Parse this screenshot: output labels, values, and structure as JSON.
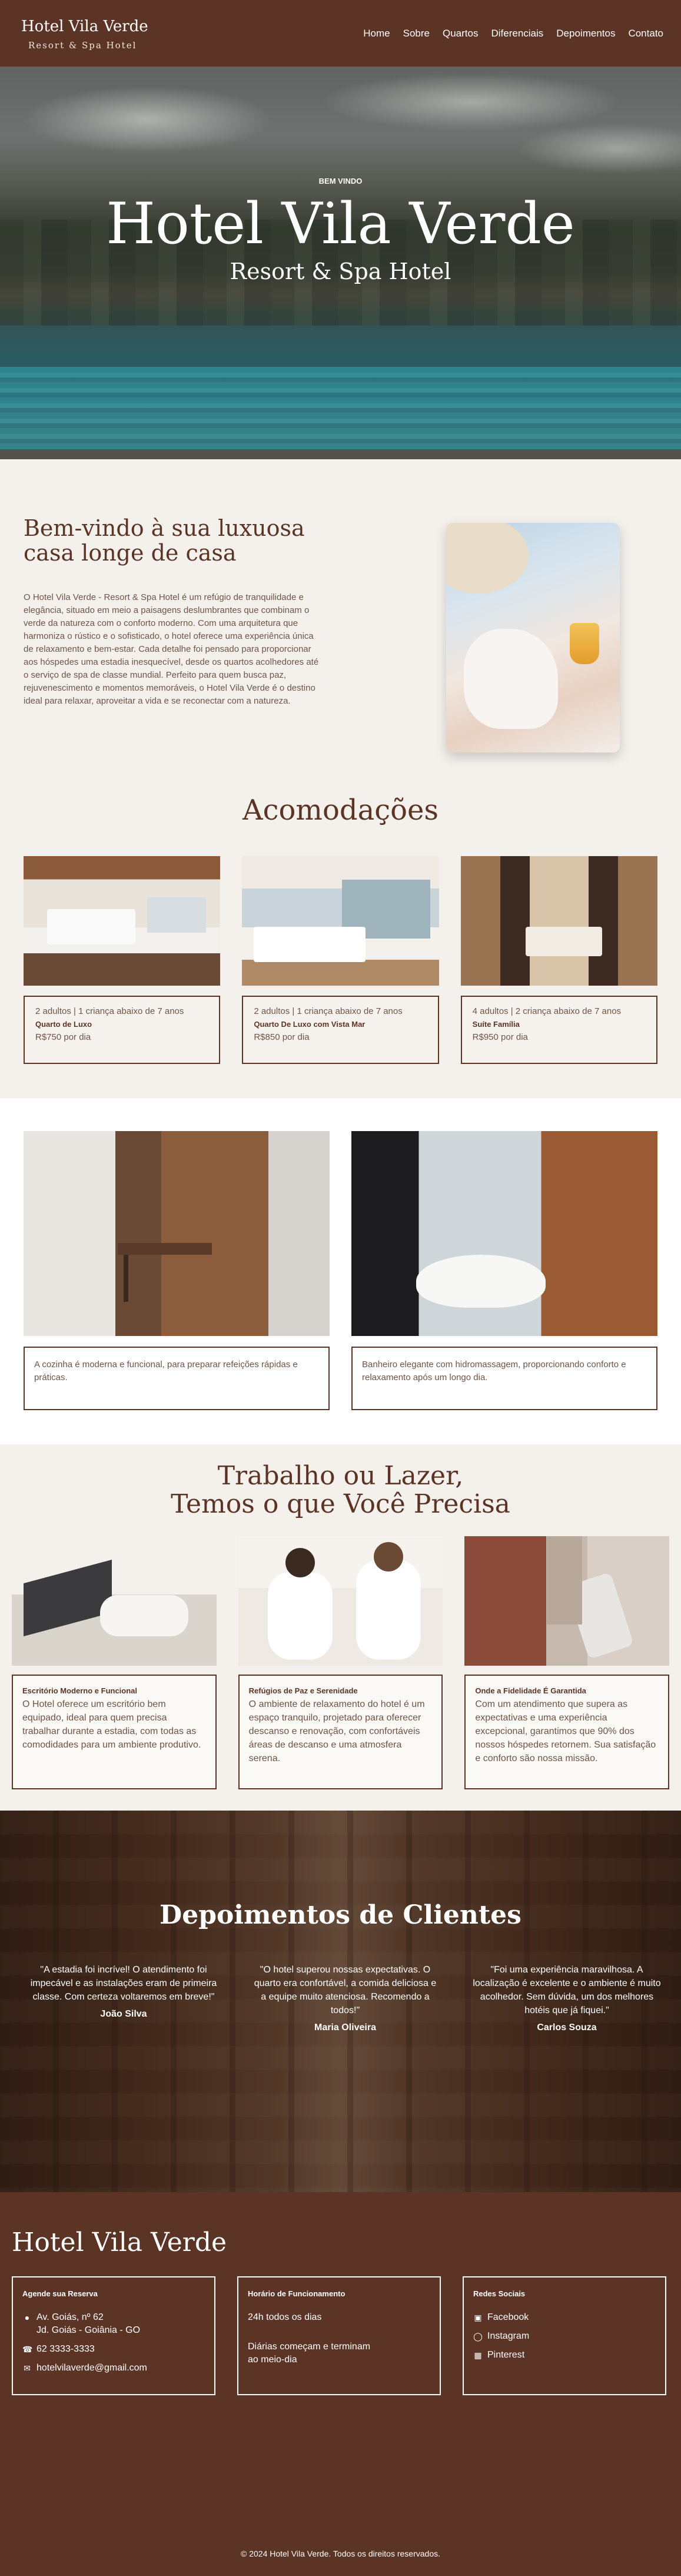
{
  "header": {
    "logo_title": "Hotel Vila Verde",
    "logo_subtitle": "Resort & Spa Hotel",
    "nav": [
      "Home",
      "Sobre",
      "Quartos",
      "Diferenciais",
      "Depoimentos",
      "Contato"
    ]
  },
  "hero": {
    "kicker": "BEM VINDO",
    "title": "Hotel Vila Verde",
    "subtitle": "Resort & Spa Hotel"
  },
  "welcome": {
    "heading": "Bem-vindo à sua luxuosa casa longe de casa",
    "body": "O Hotel Vila Verde - Resort & Spa Hotel é um refúgio de tranquilidade e elegância, situado em meio a paisagens deslumbrantes que combinam o verde da natureza com o conforto moderno. Com uma arquitetura que harmoniza o rústico e o sofisticado, o hotel oferece uma experiência única de relaxamento e bem-estar. Cada detalhe foi pensado para proporcionar aos hóspedes uma estadia inesquecível, desde os quartos acolhedores até o serviço de spa de classe mundial. Perfeito para quem busca paz, rejuvenescimento e momentos memoráveis, o Hotel Vila Verde é o destino ideal para relaxar, aproveitar a vida e se reconectar com a natureza."
  },
  "accommodations": {
    "title": "Acomodações",
    "rooms": [
      {
        "occupancy": "2 adultos | 1 criança abaixo de 7 anos",
        "name": "Quarto de Luxo",
        "price": "R$750 por dia"
      },
      {
        "occupancy": "2 adultos | 1 criança abaixo de 7 anos",
        "name": "Quarto De Luxo com Vista Mar",
        "price": "R$850 por dia"
      },
      {
        "occupancy": "4 adultos | 2 criança abaixo de 7 anos",
        "name": "Suíte Família",
        "price": "R$950 por dia"
      }
    ],
    "features": [
      {
        "text": "A cozinha é moderna e funcional, para preparar refeições rápidas e práticas."
      },
      {
        "text": "Banheiro elegante com hidromassagem, proporcionando conforto e relaxamento após um longo dia."
      }
    ]
  },
  "work": {
    "title_line1": "Trabalho ou Lazer,",
    "title_line2": "Temos o que Você Precisa",
    "items": [
      {
        "title": "Escritório Moderno e Funcional",
        "text": "O Hotel oferece um escritório bem equipado, ideal para quem precisa trabalhar durante a estadia, com todas as comodidades para um ambiente produtivo."
      },
      {
        "title": "Refúgios de Paz e Serenidade",
        "text": "O ambiente de relaxamento do hotel é um espaço tranquilo, projetado para oferecer descanso e renovação, com confortáveis áreas de descanso e uma atmosfera serena."
      },
      {
        "title": "Onde a Fidelidade É Garantida",
        "text": "Com um atendimento que supera as expectativas e uma experiência excepcional, garantimos que 90% dos nossos hóspedes retornem. Sua satisfação e conforto são nossa missão."
      }
    ]
  },
  "testimonials": {
    "title": "Depoimentos de Clientes",
    "items": [
      {
        "quote": "\"A estadia foi incrível! O atendimento foi impecável e as instalações eram de primeira classe. Com certeza voltaremos em breve!\"",
        "author": "João Silva"
      },
      {
        "quote": "\"O hotel superou nossas expectativas. O quarto era confortável, a comida deliciosa e a equipe muito atenciosa. Recomendo a todos!\"",
        "author": "Maria Oliveira"
      },
      {
        "quote": "\"Foi uma experiência maravilhosa. A localização é excelente e o ambiente é muito acolhedor. Sem dúvida, um dos melhores hotéis que já fiquei.\"",
        "author": "Carlos Souza"
      }
    ]
  },
  "footer": {
    "title": "Hotel Vila Verde",
    "reservation": {
      "heading": "Agende sua Reserva",
      "address_line1": "Av. Goiás, nº 62",
      "address_line2": "Jd. Goiás - Goiânia - GO",
      "phone": "62 3333-3333",
      "email": "hotelvilaverde@gmail.com"
    },
    "hours": {
      "heading": "Horário de Funcionamento",
      "line1": "24h todos os dias",
      "line2": "Diárias começam e terminam ao meio-dia"
    },
    "social": {
      "heading": "Redes Sociais",
      "facebook": "Facebook",
      "instagram": "Instagram",
      "pinterest": "Pinterest"
    },
    "copyright": "© 2024 Hotel Vila Verde. Todos os direitos reservados."
  }
}
